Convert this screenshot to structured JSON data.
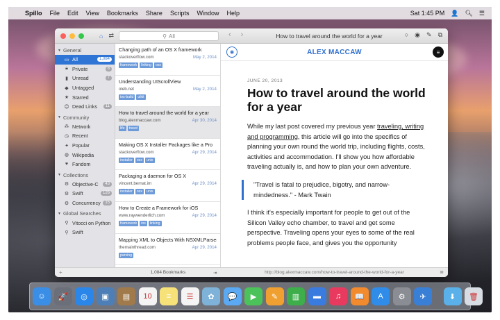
{
  "menubar": {
    "app_name": "Spillo",
    "items": [
      "File",
      "Edit",
      "View",
      "Bookmarks",
      "Share",
      "Scripts",
      "Window",
      "Help"
    ],
    "clock": "Sat 1:45 PM"
  },
  "titlebar": {
    "search_placeholder": "All",
    "page_title": "How to travel around the world for a year"
  },
  "sidebar": {
    "general_label": "General",
    "general_items": [
      {
        "label": "All",
        "count": "1,084",
        "icon": "tray-icon"
      },
      {
        "label": "Private",
        "count": "8",
        "icon": "lock-icon"
      },
      {
        "label": "Unread",
        "count": "7",
        "icon": "bookmark-icon"
      },
      {
        "label": "Untagged",
        "count": "",
        "icon": "tag-icon"
      },
      {
        "label": "Starred",
        "count": "",
        "icon": "star-icon"
      },
      {
        "label": "Dead Links",
        "count": "11",
        "icon": "dead-link-icon"
      }
    ],
    "community_label": "Community",
    "community_items": [
      {
        "label": "Network",
        "icon": "network-icon"
      },
      {
        "label": "Recent",
        "icon": "clock-icon"
      },
      {
        "label": "Popular",
        "icon": "popular-icon"
      },
      {
        "label": "Wikipedia",
        "icon": "globe-icon"
      },
      {
        "label": "Fandom",
        "icon": "heart-icon"
      }
    ],
    "collections_label": "Collections",
    "collection_items": [
      {
        "label": "Objective-C",
        "count": "43"
      },
      {
        "label": "Swift",
        "count": "126"
      },
      {
        "label": "Concurrency",
        "count": "15"
      }
    ],
    "searches_label": "Global Searches",
    "search_items": [
      {
        "label": "Vitocci on Python"
      },
      {
        "label": "Swift"
      }
    ]
  },
  "bookmarks": [
    {
      "title": "Changing path of an OS X framework",
      "source": "stackoverflow.com",
      "date": "May 2, 2014",
      "tags": [
        "framework",
        "linking",
        "osx"
      ]
    },
    {
      "title": "Understanding UIScrollView",
      "source": "oleb.net",
      "date": "May 2, 2014",
      "tags": [
        "ios-build",
        "uikit"
      ]
    },
    {
      "title": "How to travel around the world for a year",
      "source": "blog.alexmaccaw.com",
      "date": "Apr 30, 2014",
      "tags": [
        "life",
        "travel"
      ]
    },
    {
      "title": "Making OS X Installer Packages like a Pro",
      "source": "stackoverflow.com",
      "date": "Apr 29, 2014",
      "tags": [
        "installer",
        "osx",
        "unix"
      ]
    },
    {
      "title": "Packaging a daemon for OS X",
      "source": "vincent.bernat.im",
      "date": "Apr 29, 2014",
      "tags": [
        "installer",
        "osx",
        "unix"
      ]
    },
    {
      "title": "How to Create a Framework for iOS",
      "source": "www.raywenderlich.com",
      "date": "Apr 29, 2014",
      "tags": [
        "framework",
        "ios",
        "linking"
      ]
    },
    {
      "title": "Mapping XML to Objects With NSXMLParser",
      "source": "themainthread.com",
      "date": "Apr 29, 2014",
      "tags": [
        "parsing"
      ]
    }
  ],
  "reader": {
    "site_name": "ALEX MACCAW",
    "date": "JUNE 20, 2013",
    "title": "How to travel around the world for a year",
    "p1_start": "While my last post covered my previous year ",
    "p1_link": "traveling, writing and programming",
    "p1_end": ", this article will go into the specifics of planning your own round the world trip, including flights, costs, activities and accommodation. I'll show you how affordable traveling actually is, and how to plan your own adventure.",
    "quote": "\"Travel is fatal to prejudice, bigotry, and narrow-mindedness.\" - Mark Twain",
    "p2": "I think it's especially important for people to get out of the Silicon Valley echo chamber, to travel and get some perspective. Traveling opens your eyes to some of the real problems people face, and gives you the opportunity"
  },
  "statusbar": {
    "bookmark_count": "1,084 Bookmarks",
    "url": "http://blog.alexmaccaw.com/how-to-travel-around-the-world-for-a-year"
  },
  "dock": {
    "apps": [
      {
        "name": "finder-icon",
        "color": "#3a8ee6",
        "glyph": "☺"
      },
      {
        "name": "launchpad-icon",
        "color": "#6b6f7a",
        "glyph": "🚀"
      },
      {
        "name": "safari-icon",
        "color": "#2a86e8",
        "glyph": "◎"
      },
      {
        "name": "preview-icon",
        "color": "#4d7fb6",
        "glyph": "▣"
      },
      {
        "name": "contacts-icon",
        "color": "#a07a4a",
        "glyph": "▤"
      },
      {
        "name": "calendar-icon",
        "color": "#f4f4f4",
        "glyph": "10"
      },
      {
        "name": "notes-icon",
        "color": "#f7e27a",
        "glyph": "≡"
      },
      {
        "name": "reminders-icon",
        "color": "#f4f4f4",
        "glyph": "☰"
      },
      {
        "name": "photos-icon",
        "color": "#7fb2d8",
        "glyph": "✿"
      },
      {
        "name": "messages-icon",
        "color": "#5aa9f2",
        "glyph": "💬"
      },
      {
        "name": "facetime-icon",
        "color": "#4cc25a",
        "glyph": "▶"
      },
      {
        "name": "pages-icon",
        "color": "#f0a030",
        "glyph": "✎"
      },
      {
        "name": "numbers-icon",
        "color": "#3dae4a",
        "glyph": "▥"
      },
      {
        "name": "keynote-icon",
        "color": "#3a7be0",
        "glyph": "▬"
      },
      {
        "name": "itunes-icon",
        "color": "#e83a5e",
        "glyph": "♫"
      },
      {
        "name": "ibooks-icon",
        "color": "#f28a2e",
        "glyph": "📖"
      },
      {
        "name": "app-store-icon",
        "color": "#2f8ce8",
        "glyph": "A"
      },
      {
        "name": "system-preferences-icon",
        "color": "#8a8d94",
        "glyph": "⚙"
      },
      {
        "name": "spillo-icon",
        "color": "#3a7fd6",
        "glyph": "✈"
      }
    ],
    "right_apps": [
      {
        "name": "downloads-folder-icon",
        "color": "#5ab0e8",
        "glyph": "⬇"
      },
      {
        "name": "trash-icon",
        "color": "#d8dde3",
        "glyph": "🗑"
      }
    ]
  }
}
